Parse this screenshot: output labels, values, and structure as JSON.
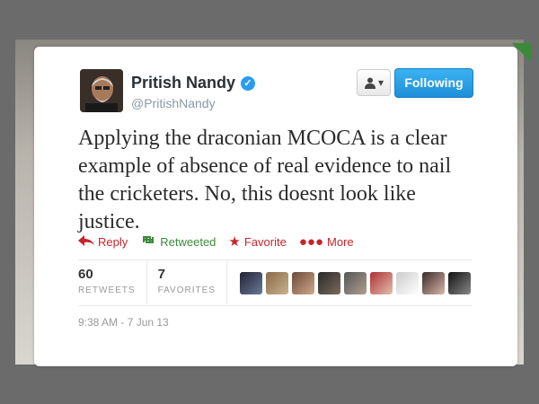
{
  "user": {
    "display_name": "Pritish Nandy",
    "handle": "@PritishNandy",
    "verified_glyph": "✓"
  },
  "buttons": {
    "user_menu_icon": "person-icon",
    "follow_label": "Following"
  },
  "tweet": {
    "text": "Applying the draconian MCOCA is a clear example of absence of real evidence to nail the cricketers. No, this doesnt look like justice."
  },
  "actions": {
    "reply": "Reply",
    "retweet": "Retweeted",
    "favorite": "Favorite",
    "more": "More"
  },
  "stats": {
    "retweets_count": "60",
    "retweets_label": "RETWEETS",
    "favorites_count": "7",
    "favorites_label": "FAVORITES"
  },
  "timestamp": "9:38 AM - 7 Jun 13",
  "colors": {
    "follow_button": "#1e8fd9",
    "reply_red": "#c6242a",
    "retweet_green": "#3c8a3c"
  }
}
